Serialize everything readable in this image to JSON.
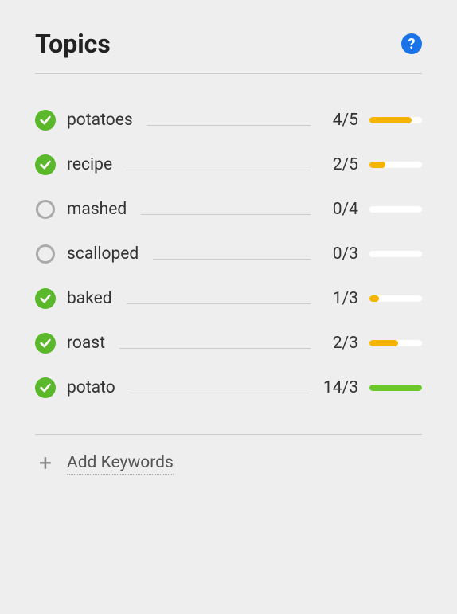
{
  "header": {
    "title": "Topics",
    "help_glyph": "?"
  },
  "topics": [
    {
      "label": "potatoes",
      "current": 4,
      "target": 5,
      "checked": true,
      "bar_color": "yellow",
      "bar_pct": 80
    },
    {
      "label": "recipe",
      "current": 2,
      "target": 5,
      "checked": true,
      "bar_color": "yellow",
      "bar_pct": 30
    },
    {
      "label": "mashed",
      "current": 0,
      "target": 4,
      "checked": false,
      "bar_color": "none",
      "bar_pct": 0
    },
    {
      "label": "scalloped",
      "current": 0,
      "target": 3,
      "checked": false,
      "bar_color": "none",
      "bar_pct": 0
    },
    {
      "label": "baked",
      "current": 1,
      "target": 3,
      "checked": true,
      "bar_color": "yellow",
      "bar_pct": 18
    },
    {
      "label": "roast",
      "current": 2,
      "target": 3,
      "checked": true,
      "bar_color": "yellow",
      "bar_pct": 55
    },
    {
      "label": "potato",
      "current": 14,
      "target": 3,
      "checked": true,
      "bar_color": "green",
      "bar_pct": 100
    }
  ],
  "footer": {
    "add_label": "Add Keywords",
    "plus_glyph": "+"
  }
}
